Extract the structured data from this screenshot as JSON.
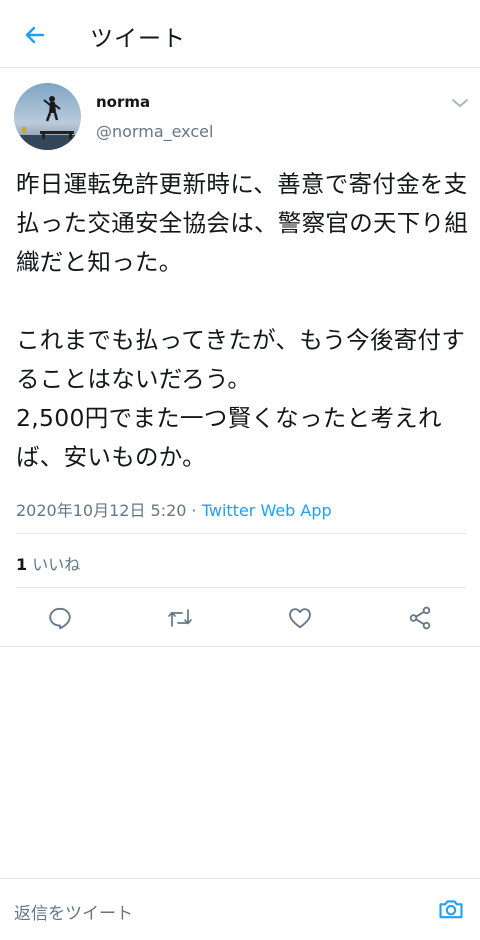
{
  "header": {
    "title": "ツイート"
  },
  "tweet": {
    "author_name": "norma",
    "author_handle": "@norma_excel",
    "text": "昨日運転免許更新時に、善意で寄付金を支払った交通安全協会は、警察官の天下り組織だと知った。\n\nこれまでも払ってきたが、もう今後寄付することはないだろう。\n2,500円でまた一つ賢くなったと考えれば、安いものか。",
    "datetime": "2020年10月12日 5:20",
    "separator": " · ",
    "source": "Twitter Web App",
    "like_count": "1",
    "like_label": " いいね"
  },
  "reply": {
    "placeholder": "返信をツイート"
  },
  "colors": {
    "accent": "#1da1f2",
    "secondary_text": "#657786",
    "border": "#e1e8ed"
  },
  "icons": {
    "back": "arrow-left-icon",
    "menu": "chevron-down-icon",
    "reply": "comment-icon",
    "retweet": "retweet-icon",
    "like": "heart-icon",
    "share": "share-icon",
    "camera": "camera-icon"
  }
}
